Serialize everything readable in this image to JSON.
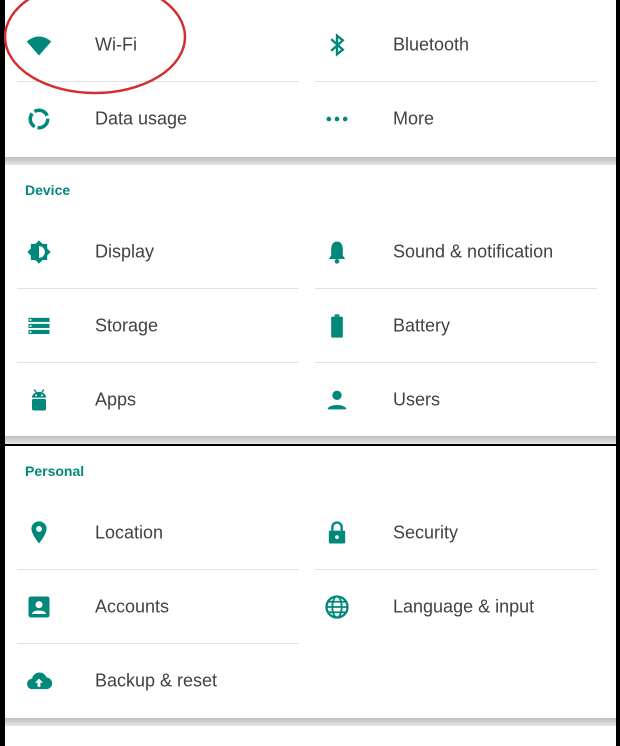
{
  "accent_color": "#00897b",
  "annotation_color": "#d32f2f",
  "wireless": {
    "items": [
      {
        "label": "Wi-Fi",
        "icon": "wifi-icon"
      },
      {
        "label": "Bluetooth",
        "icon": "bluetooth-icon"
      },
      {
        "label": "Data usage",
        "icon": "data-usage-icon"
      },
      {
        "label": "More",
        "icon": "more-dots-icon"
      }
    ]
  },
  "device": {
    "title": "Device",
    "items": [
      {
        "label": "Display",
        "icon": "brightness-icon"
      },
      {
        "label": "Sound & notification",
        "icon": "bell-icon"
      },
      {
        "label": "Storage",
        "icon": "storage-icon"
      },
      {
        "label": "Battery",
        "icon": "battery-icon"
      },
      {
        "label": "Apps",
        "icon": "android-icon"
      },
      {
        "label": "Users",
        "icon": "person-icon"
      }
    ]
  },
  "personal": {
    "title": "Personal",
    "items": [
      {
        "label": "Location",
        "icon": "location-pin-icon"
      },
      {
        "label": "Security",
        "icon": "lock-icon"
      },
      {
        "label": "Accounts",
        "icon": "account-box-icon"
      },
      {
        "label": "Language & input",
        "icon": "globe-icon"
      },
      {
        "label": "Backup & reset",
        "icon": "cloud-upload-icon"
      }
    ]
  }
}
